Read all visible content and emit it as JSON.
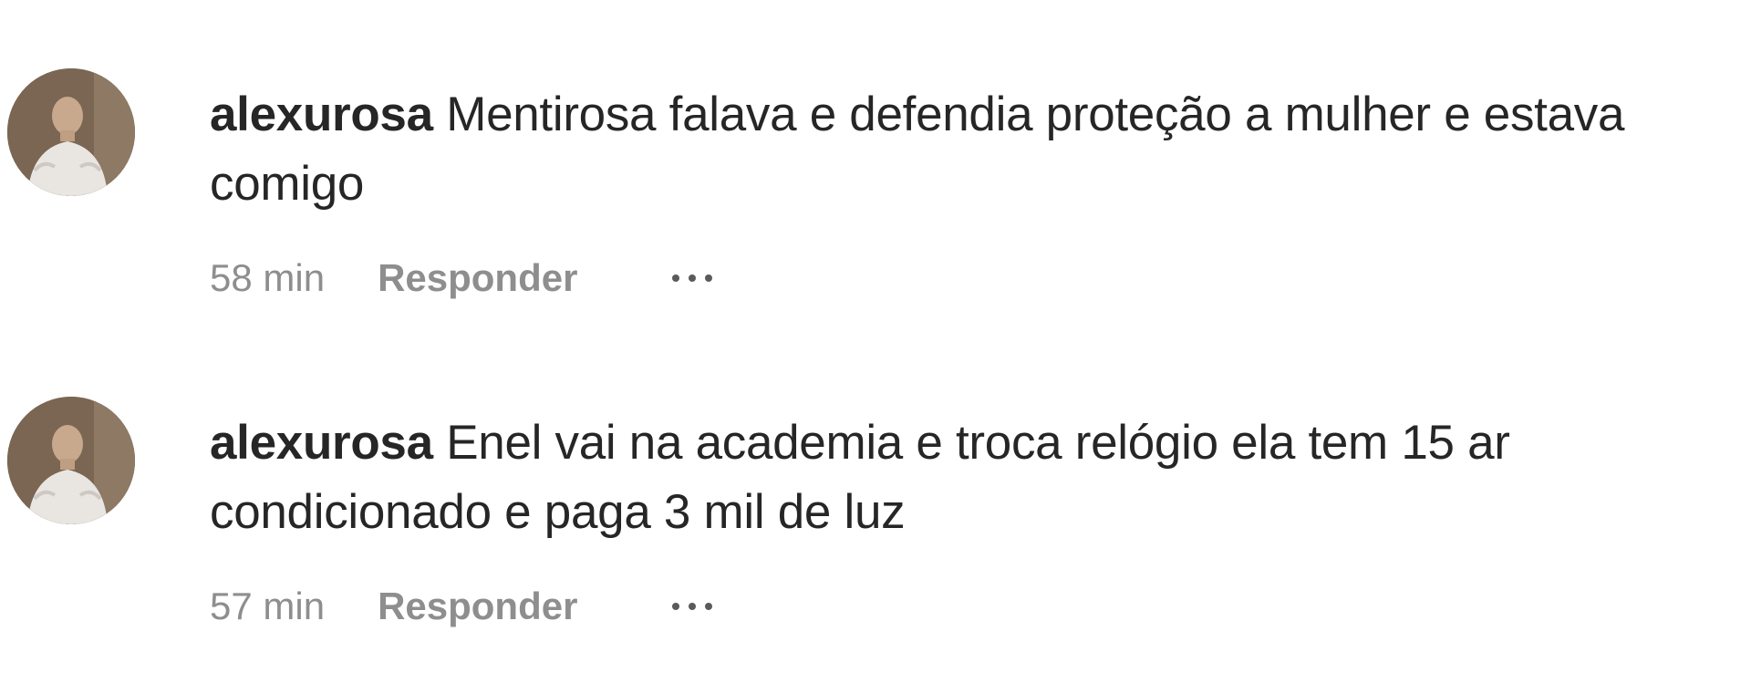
{
  "comments": [
    {
      "username": "alexurosa",
      "text": "Mentirosa falava e defendia proteção a mulher e estava comigo",
      "timestamp": "58 min",
      "reply_label": "Responder",
      "avatar_icon": "profile-photo"
    },
    {
      "username": "alexurosa",
      "text": "Enel vai na academia e troca relógio ela tem 15 ar condicionado e paga 3 mil de luz",
      "timestamp": "57 min",
      "reply_label": "Responder",
      "avatar_icon": "profile-photo"
    }
  ],
  "more_icon": "more-options-icon",
  "colors": {
    "text_primary": "#262626",
    "text_secondary": "#8e8e8e",
    "background": "#ffffff"
  }
}
